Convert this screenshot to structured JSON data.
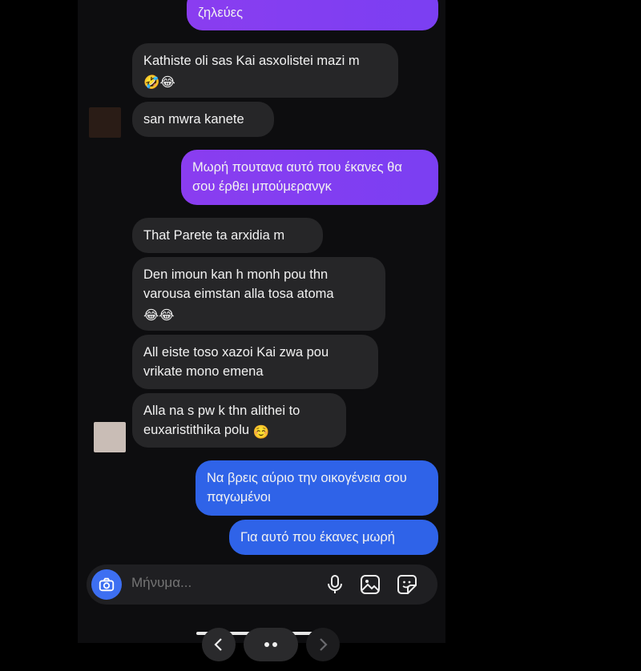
{
  "messages": [
    {
      "id": "m0",
      "side": "out",
      "color": "purple",
      "text": "ζηλεύες"
    },
    {
      "id": "m1",
      "side": "in",
      "text": "Kathiste oli sas Kai asxolistei mazi m",
      "emoji": "🤣😂"
    },
    {
      "id": "m2",
      "side": "in",
      "text": "san mwra kanete"
    },
    {
      "id": "m3",
      "side": "out",
      "color": "purple",
      "text": "Μωρή πουτανα αυτό που έκανες θα σου έρθει μπούμερανγκ"
    },
    {
      "id": "m4",
      "side": "in",
      "text": "That Parete ta arxidia m"
    },
    {
      "id": "m5",
      "side": "in",
      "text": "Den imoun kan h monh pou thn varousa eimstan alla tosa atoma",
      "emoji": "😂😂"
    },
    {
      "id": "m6",
      "side": "in",
      "text": "All eiste toso xazoi Kai zwa pou vrikate mono emena"
    },
    {
      "id": "m7",
      "side": "in",
      "text": "Alla na s pw k thn alithei to euxaristithika polu",
      "emoji": "☺️"
    },
    {
      "id": "m8",
      "side": "out",
      "color": "blue",
      "text": "Να βρεις αύριο την οικογένεια σου παγωμένοι"
    },
    {
      "id": "m9",
      "side": "out",
      "color": "blue",
      "text": "Για αυτό που έκανες μωρή"
    }
  ],
  "composer": {
    "placeholder": "Μήνυμα...",
    "icons": [
      "camera-icon",
      "microphone-icon",
      "image-icon",
      "sticker-icon"
    ]
  },
  "nav": {
    "back_icon": "chevron-left-icon",
    "more_icon": "dots-icon",
    "forward_icon": "chevron-right-icon"
  },
  "colors": {
    "background": "#0d0d0f",
    "incoming_bubble": "#262628",
    "outgoing_purple": "#7b3ff2",
    "outgoing_blue": "#2f63e8",
    "camera_button": "#3d6ff2"
  }
}
